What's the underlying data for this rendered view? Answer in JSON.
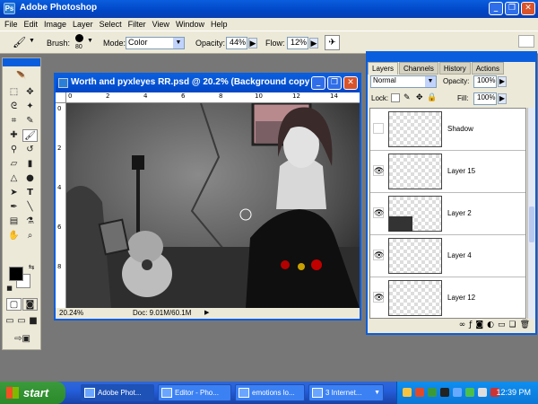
{
  "app": {
    "title": "Adobe Photoshop",
    "icon_letter": "Ps",
    "window_buttons": [
      "_",
      "❐",
      "✕"
    ]
  },
  "menu": [
    "File",
    "Edit",
    "Image",
    "Layer",
    "Select",
    "Filter",
    "View",
    "Window",
    "Help"
  ],
  "options_bar": {
    "brush_label": "Brush:",
    "brush_size": "80",
    "mode_label": "Mode:",
    "mode_value": "Color",
    "opacity_label": "Opacity:",
    "opacity_value": "44%",
    "flow_label": "Flow:",
    "flow_value": "12%"
  },
  "document": {
    "title": "Worth and pyxleyes RR.psd @ 20.2% (Background copy ...",
    "zoom": "20.24%",
    "doc_info": "Doc: 9.01M/60.1M",
    "ruler_h": [
      "0",
      "2",
      "4",
      "6",
      "8",
      "10",
      "12",
      "14"
    ],
    "ruler_v": [
      "0",
      "2",
      "4",
      "6",
      "8"
    ]
  },
  "layers_panel": {
    "tabs": [
      "Layers",
      "Channels",
      "History",
      "Actions"
    ],
    "blend_mode": "Normal",
    "opacity_label": "Opacity:",
    "opacity_value": "100%",
    "lock_label": "Lock:",
    "fill_label": "Fill:",
    "fill_value": "100%",
    "layers": [
      {
        "name": "Shadow",
        "visible": false
      },
      {
        "name": "Layer 15",
        "visible": true
      },
      {
        "name": "Layer 2",
        "visible": true
      },
      {
        "name": "Layer 4",
        "visible": true
      },
      {
        "name": "Layer 12",
        "visible": true
      }
    ]
  },
  "taskbar": {
    "start_label": "start",
    "tasks": [
      {
        "label": "Adobe Phot...",
        "active": true
      },
      {
        "label": "Editor - Pho...",
        "active": false
      },
      {
        "label": "emotions lo...",
        "active": false
      },
      {
        "label": "3 Internet...",
        "active": false
      }
    ],
    "clock": "12:39 PM"
  },
  "colors": {
    "xp_blue": "#0a5ede",
    "panel_bg": "#ece9d8",
    "start_green": "#3c9a3c",
    "workspace": "#777777"
  }
}
